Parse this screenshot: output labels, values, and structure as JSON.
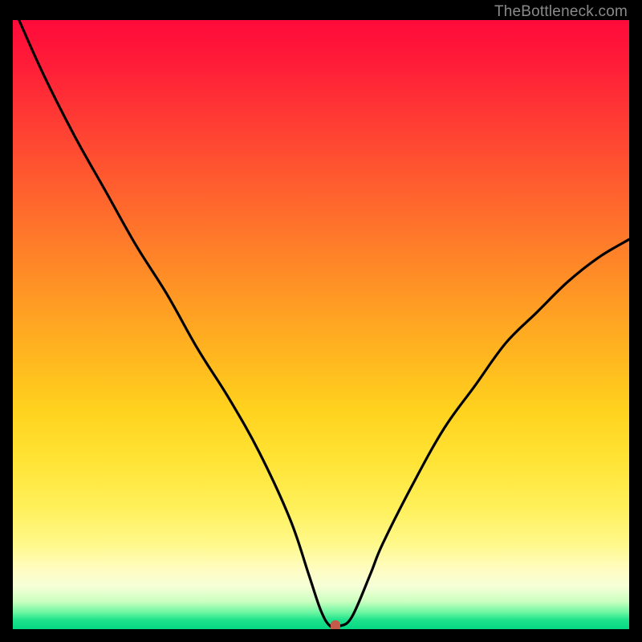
{
  "watermark": "TheBottleneck.com",
  "colors": {
    "frame": "#000000",
    "curve": "#000000",
    "marker": "#c35a4a"
  },
  "chart_data": {
    "type": "line",
    "title": "",
    "xlabel": "",
    "ylabel": "",
    "xlim": [
      0,
      100
    ],
    "ylim": [
      0,
      100
    ],
    "grid": false,
    "series": [
      {
        "name": "bottleneck-curve",
        "x": [
          1,
          5,
          10,
          15,
          20,
          25,
          30,
          35,
          40,
          45,
          48,
          50,
          51.5,
          53,
          55,
          58,
          60,
          65,
          70,
          75,
          80,
          85,
          90,
          95,
          100
        ],
        "y": [
          100,
          91,
          81,
          72,
          63,
          55,
          46,
          38,
          29,
          18,
          9,
          3,
          0.5,
          0.5,
          2,
          9,
          14,
          24,
          33,
          40,
          47,
          52,
          57,
          61,
          64
        ]
      }
    ],
    "marker": {
      "x": 52.3,
      "y": 0.5
    },
    "gradient_note": "vertical red→yellow→green heatmap background"
  }
}
